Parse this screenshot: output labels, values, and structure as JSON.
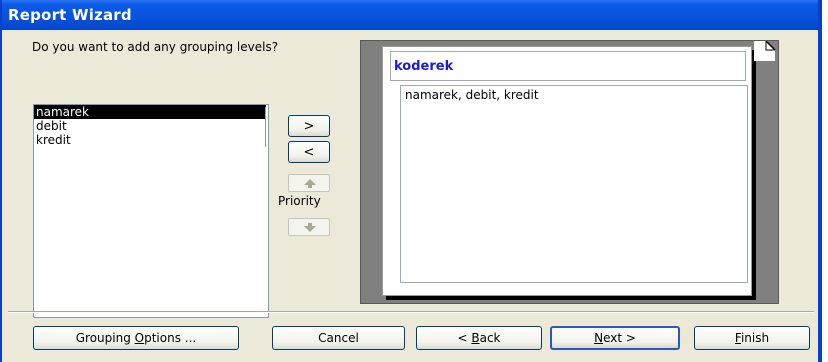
{
  "window": {
    "title": "Report Wizard"
  },
  "prompt": {
    "question": "Do you want to add any grouping levels?"
  },
  "fields": {
    "items": [
      {
        "label": "namarek",
        "selected": true
      },
      {
        "label": "debit",
        "selected": false
      },
      {
        "label": "kredit",
        "selected": false
      }
    ]
  },
  "controls": {
    "add_label": ">",
    "remove_label": "<",
    "priority_label": "Priority"
  },
  "preview": {
    "group_header": "koderek",
    "detail_fields": "namarek, debit, kredit"
  },
  "buttons": {
    "grouping_options": {
      "before": "Grouping ",
      "mnemonic": "O",
      "after": "ptions ..."
    },
    "cancel": "Cancel",
    "back": {
      "before": "< ",
      "mnemonic": "B",
      "after": "ack"
    },
    "next": {
      "before": "",
      "mnemonic": "N",
      "after": "ext >"
    },
    "finish": {
      "before": "",
      "mnemonic": "F",
      "after": "inish"
    }
  },
  "colors": {
    "titlebar": "#0852dc",
    "window_bg": "#ece9d8",
    "group_header_text": "#1a1ad8",
    "selection": "#000000"
  }
}
